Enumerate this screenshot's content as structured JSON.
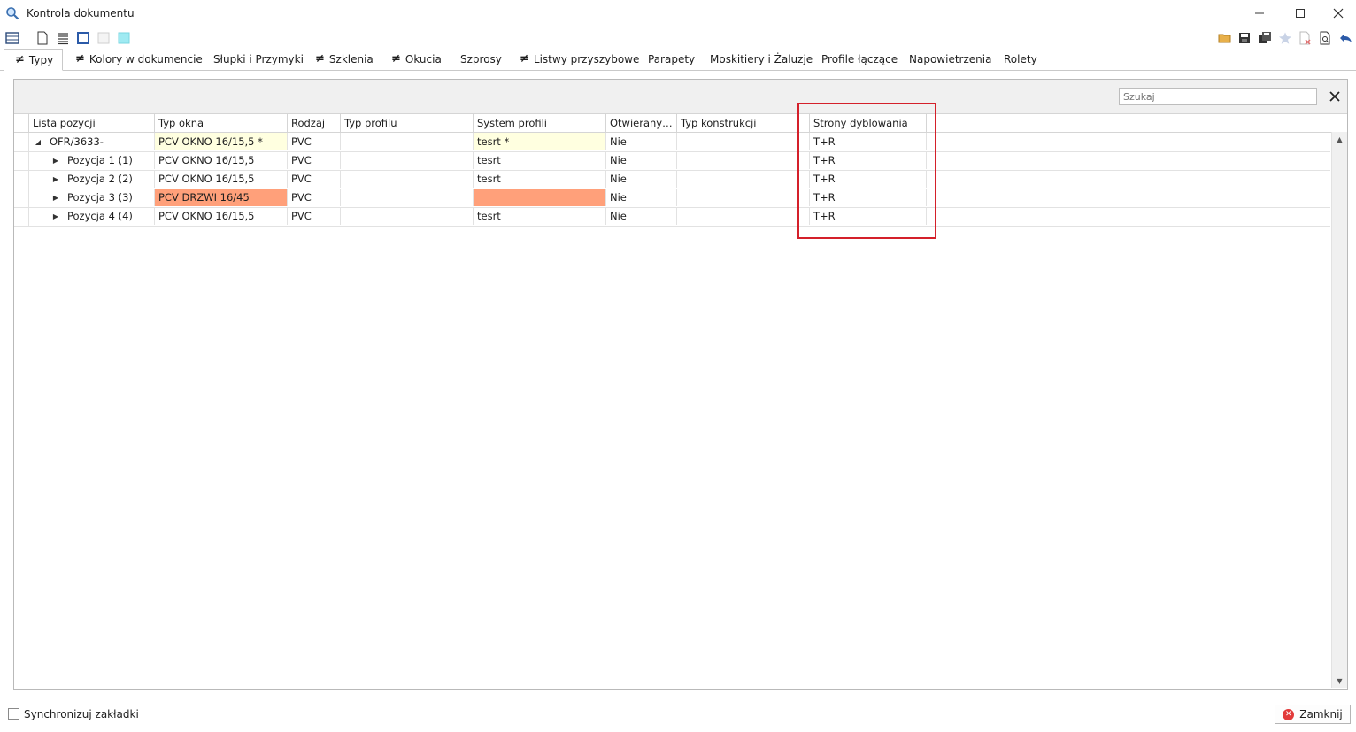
{
  "window": {
    "title": "Kontrola dokumentu",
    "minimize": "—",
    "maximize": "☐",
    "close": "✕"
  },
  "toolbar": {
    "left_icons": [
      "grid-layout-icon",
      "new-document-icon",
      "list-icon",
      "square-outline-icon",
      "square-light-icon",
      "square-cyan-icon"
    ],
    "right_icons": [
      "open-folder-icon",
      "save-icon",
      "save-all-icon",
      "star-icon",
      "delete-document-icon",
      "preview-icon",
      "undo-arrow-icon"
    ]
  },
  "tabs": [
    {
      "label": "Typy",
      "has_icon": true,
      "active": true
    },
    {
      "label": "Kolory w dokumencie",
      "has_icon": true
    },
    {
      "label": "Słupki i Przymyki",
      "has_icon": false
    },
    {
      "label": "Szklenia",
      "has_icon": true
    },
    {
      "label": "Okucia",
      "has_icon": true
    },
    {
      "label": "Szprosy",
      "has_icon": false
    },
    {
      "label": "Listwy przyszybowe",
      "has_icon": true
    },
    {
      "label": "Parapety",
      "has_icon": false
    },
    {
      "label": "Moskitiery i Żaluzje",
      "has_icon": false
    },
    {
      "label": "Profile łączące",
      "has_icon": false
    },
    {
      "label": "Napowietrzenia",
      "has_icon": false
    },
    {
      "label": "Rolety",
      "has_icon": false
    }
  ],
  "search": {
    "placeholder": "Szukaj",
    "clear": "✕"
  },
  "grid": {
    "columns": [
      "Lista pozycji",
      "Typ okna",
      "Rodzaj",
      "Typ profilu",
      "System profili",
      "Otwierany…",
      "Typ konstrukcji",
      "Strony dyblowania"
    ],
    "rows": [
      {
        "name": "OFR/3633-",
        "typ_okna": "PCV OKNO 16/15,5  *",
        "rodzaj": "PVC",
        "typ_profilu": "",
        "system_profili": "tesrt  *",
        "otwierany": "Nie",
        "typ_konstrukcji": "",
        "strony": "T+R",
        "expanded": true
      },
      {
        "name": "Pozycja 1 (1)",
        "typ_okna": "PCV OKNO 16/15,5",
        "rodzaj": "PVC",
        "typ_profilu": "",
        "system_profili": "tesrt",
        "otwierany": "Nie",
        "typ_konstrukcji": "",
        "strony": "T+R"
      },
      {
        "name": "Pozycja 2 (2)",
        "typ_okna": "PCV OKNO 16/15,5",
        "rodzaj": "PVC",
        "typ_profilu": "",
        "system_profili": "tesrt",
        "otwierany": "Nie",
        "typ_konstrukcji": "",
        "strony": "T+R"
      },
      {
        "name": "Pozycja 3 (3)",
        "typ_okna": "PCV DRZWI 16/45",
        "rodzaj": "PVC",
        "typ_profilu": "",
        "system_profili": "",
        "otwierany": "Nie",
        "typ_konstrukcji": "",
        "strony": "T+R"
      },
      {
        "name": "Pozycja 4 (4)",
        "typ_okna": "PCV OKNO 16/15,5",
        "rodzaj": "PVC",
        "typ_profilu": "",
        "system_profili": "tesrt",
        "otwierany": "Nie",
        "typ_konstrukcji": "",
        "strony": "T+R"
      }
    ]
  },
  "colors": {
    "modified": "#ffffe0",
    "error": "#ffa07a",
    "highlight": "#d4202a"
  },
  "footer": {
    "sync_label": "Synchronizuj zakładki",
    "sync_checked": false,
    "close_label": "Zamknij"
  }
}
